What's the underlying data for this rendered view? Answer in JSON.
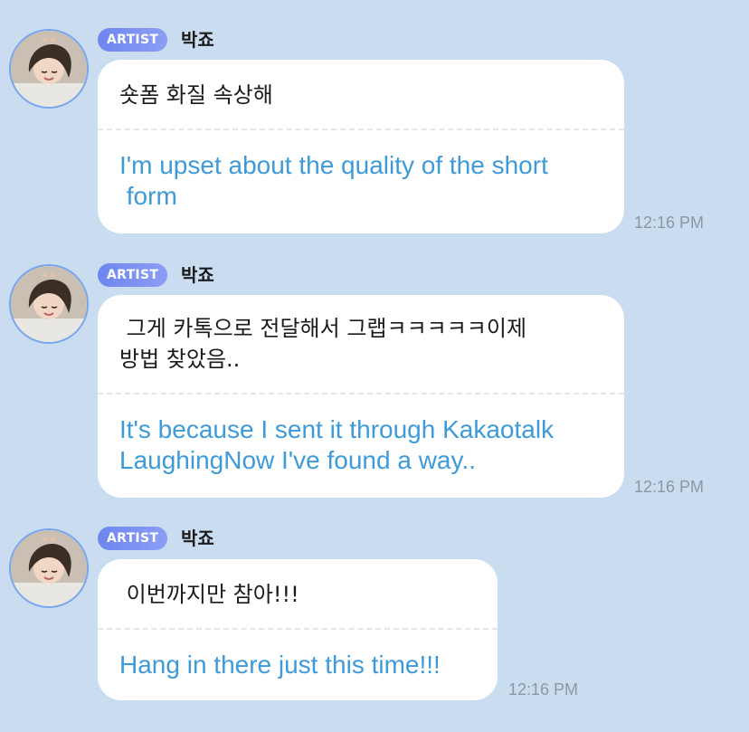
{
  "messages": [
    {
      "badge": "ARTIST",
      "sender": "박죠",
      "original": "숏폼 화질 속상해",
      "translation": "I'm upset about the quality of the short\n form",
      "time": "12:16 PM",
      "avatar_icon": "profile-photo-icon"
    },
    {
      "badge": "ARTIST",
      "sender": "박죠",
      "original": " 그게 카톡으로 전달해서 그랩ㅋㅋㅋㅋㅋ이제\n방법 찾았음..",
      "translation": "It's because I sent it through Kakaotalk\nLaughingNow I've found a way..",
      "time": "12:16 PM",
      "avatar_icon": "profile-photo-icon"
    },
    {
      "badge": "ARTIST",
      "sender": "박죠",
      "original": " 이번까지만 참아!!!",
      "translation": "Hang in there just this time!!!",
      "time": "12:16 PM",
      "avatar_icon": "profile-photo-icon"
    }
  ],
  "colors": {
    "background": "#cadcf0",
    "bubble": "#ffffff",
    "translation_text": "#3e9ad9",
    "badge_gradient_start": "#6d86ee",
    "badge_gradient_end": "#8c9df5",
    "avatar_ring": "#76a5ef",
    "timestamp": "#8d97a3"
  }
}
